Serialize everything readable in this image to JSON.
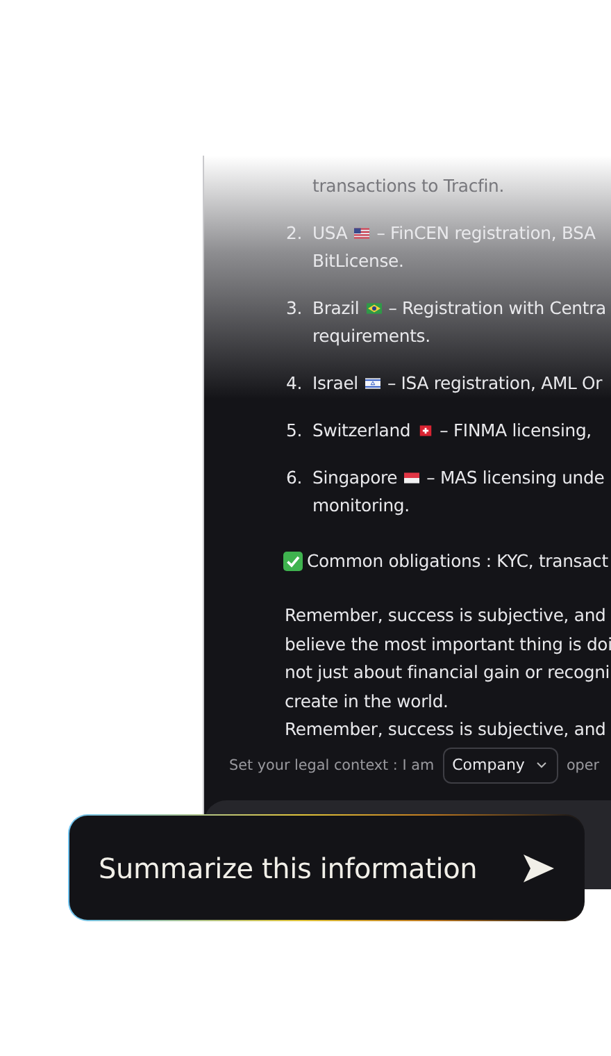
{
  "chat": {
    "list": [
      {
        "continuation": "transactions to Tracfin."
      },
      {
        "number": "2.",
        "country": "USA",
        "text": "– FinCEN registration, BSA",
        "continuation": "BitLicense."
      },
      {
        "number": "3.",
        "country": "Brazil",
        "text": "– Registration with Centra",
        "continuation": "requirements."
      },
      {
        "number": "4.",
        "country": "Israel",
        "text": "– ISA registration, AML Or"
      },
      {
        "number": "5.",
        "country": "Switzerland",
        "text": "– FINMA licensing,"
      },
      {
        "number": "6.",
        "country": "Singapore",
        "text": "– MAS licensing unde",
        "continuation": "monitoring."
      }
    ],
    "obligations": "Common obligations : KYC, transact",
    "paragraph": [
      "Remember, success is subjective, and",
      "believe the most important thing is doi",
      "not just about financial gain or recogni",
      "create in the world.",
      "Remember, success is subjective, and"
    ]
  },
  "context": {
    "label": "Set your legal context : I am",
    "select": "Company",
    "after": "oper"
  },
  "prompt": {
    "text": "Summarize this information"
  }
}
